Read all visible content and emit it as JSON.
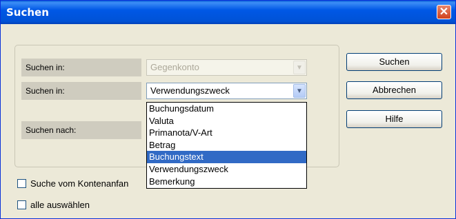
{
  "window": {
    "title": "Suchen",
    "close_glyph": "✕"
  },
  "form": {
    "row1": {
      "label": "Suchen in:",
      "value": "Gegenkonto",
      "disabled": true
    },
    "row2": {
      "label": "Suchen in:",
      "value": "Verwendungszweck"
    },
    "row3": {
      "label": "Suchen nach:"
    }
  },
  "dropdown": {
    "selected": "Buchungstext",
    "options": [
      "Buchungsdatum",
      "Valuta",
      "Primanota/V-Art",
      "Betrag",
      "Buchungstext",
      "Verwendungszweck",
      "Bemerkung"
    ]
  },
  "buttons": {
    "search": "Suchen",
    "cancel": "Abbrechen",
    "help": "Hilfe"
  },
  "checkboxes": {
    "from_start": {
      "label": "Suche vom Kontenanfan",
      "checked": false
    },
    "select_all": {
      "label": "alle auswählen",
      "checked": false
    }
  },
  "icons": {
    "dropdown_arrow": "chevron-down-icon",
    "close": "close-icon"
  },
  "colors": {
    "titlebar": "#0058e6",
    "selection": "#316ac5",
    "close": "#d1421d"
  }
}
